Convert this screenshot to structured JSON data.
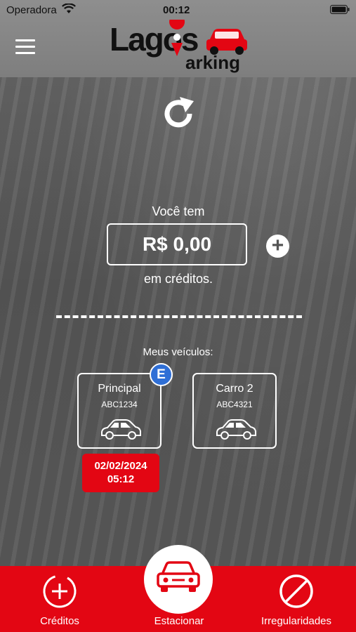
{
  "status": {
    "carrier": "Operadora",
    "time": "00:12"
  },
  "logo": {
    "text_main": "Lagos",
    "text_sub": "arking"
  },
  "credit": {
    "caption_top": "Você tem",
    "amount": "R$ 0,00",
    "caption_bottom": "em créditos.",
    "add_symbol": "+"
  },
  "vehicles": {
    "title": "Meus veículos:",
    "items": [
      {
        "name": "Principal",
        "plate": "ABC1234",
        "badge": "E",
        "parking_date": "02/02/2024",
        "parking_time": "05:12"
      },
      {
        "name": "Carro 2",
        "plate": "ABC4321"
      }
    ]
  },
  "tabs": [
    {
      "label": "Créditos",
      "icon": "add-credit-icon"
    },
    {
      "label": "Estacionar",
      "icon": "car-icon"
    },
    {
      "label": "Irregularidades",
      "icon": "prohibited-icon"
    }
  ],
  "colors": {
    "brand_red": "#e30613",
    "badge_blue": "#2f6fd6",
    "topbar": "#8e8e8e"
  }
}
